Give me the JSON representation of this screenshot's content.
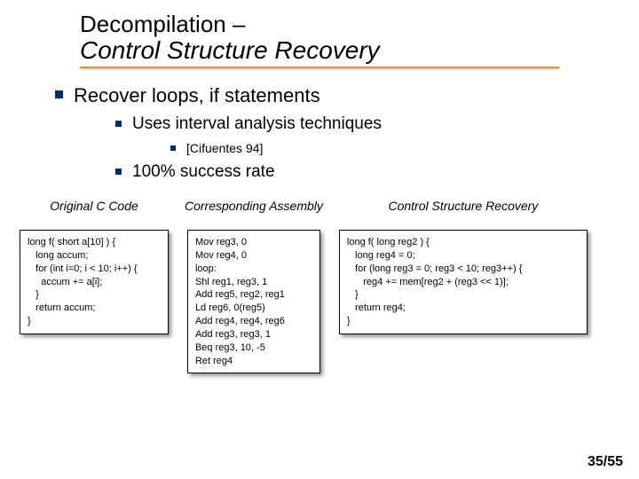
{
  "title": {
    "line1": "Decompilation –",
    "line2": "Control Structure Recovery"
  },
  "bullets": {
    "lvl1": "Recover loops, if statements",
    "lvl2a": "Uses interval analysis techniques",
    "lvl3": "[Cifuentes 94]",
    "lvl2b": "100% success rate"
  },
  "columns": {
    "col1": {
      "header": "Original C Code",
      "code": "long f( short a[10] ) {\n   long accum;\n   for (int i=0; i < 10; i++) {\n     accum += a[i];\n   }\n   return accum;\n}"
    },
    "col2": {
      "header": "Corresponding\nAssembly",
      "code": "Mov reg3, 0\nMov reg4, 0\nloop:\nShl reg1, reg3, 1\nAdd reg5, reg2, reg1\nLd reg6, 0(reg5)\nAdd reg4, reg4, reg6\nAdd reg3, reg3, 1\nBeq reg3, 10, -5\nRet reg4"
    },
    "col3": {
      "header": "Control Structure Recovery",
      "code": "long f( long reg2 ) {\n   long reg4 = 0;\n   for (long reg3 = 0; reg3 < 10; reg3++) {\n      reg4 += mem[reg2 + (reg3 << 1)];\n   }\n   return reg4;\n}"
    }
  },
  "page": "35/55"
}
